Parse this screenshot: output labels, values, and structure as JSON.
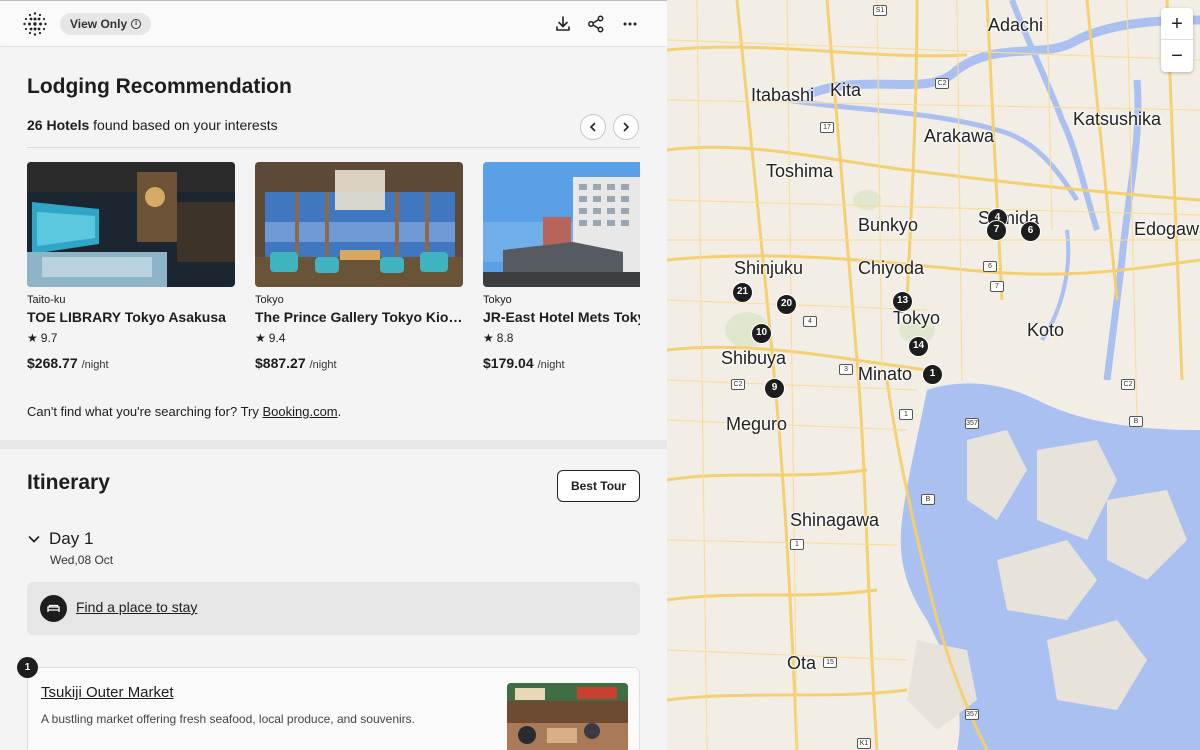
{
  "topbar": {
    "view_only_label": "View Only",
    "icons": [
      "logo-icon",
      "download-icon",
      "share-icon",
      "more-icon"
    ]
  },
  "lodging": {
    "title": "Lodging Recommendation",
    "count_number": "26 Hotels",
    "count_rest": "found based on your interests",
    "cant_find_prefix": "Can't find what you're searching for? Try",
    "cant_find_link": "Booking.com",
    "cant_find_suffix": ".",
    "hotels": [
      {
        "location": "Taito-ku",
        "name": "TOE LIBRARY Tokyo Asakusa",
        "rating": "9.7",
        "price": "$268.77",
        "unit": "/night"
      },
      {
        "location": "Tokyo",
        "name": "The Prince Gallery Tokyo Kioicho",
        "rating": "9.4",
        "price": "$887.27",
        "unit": "/night"
      },
      {
        "location": "Tokyo",
        "name": "JR-East Hotel Mets Tokyo",
        "rating": "8.8",
        "price": "$179.04",
        "unit": "/night"
      }
    ]
  },
  "itinerary": {
    "title": "Itinerary",
    "best_tour_label": "Best Tour",
    "day_label": "Day 1",
    "day_date": "Wed,08 Oct",
    "stay_link": "Find a place to stay",
    "places": [
      {
        "number": "1",
        "name": "Tsukiji Outer Market",
        "description": "A bustling market offering fresh seafood, local produce, and souvenirs."
      }
    ]
  },
  "map": {
    "zoom_in": "+",
    "zoom_out": "−",
    "labels": [
      "Adachi",
      "Itabashi",
      "Kita",
      "Katsushika",
      "Arakawa",
      "Toshima",
      "Bunkyo",
      "Sumida",
      "Edogawa",
      "Shinjuku",
      "Chiyoda",
      "Tokyo",
      "Koto",
      "Shibuya",
      "Minato",
      "Meguro",
      "Shinagawa",
      "Ota"
    ],
    "markers": [
      "4",
      "7",
      "6",
      "21",
      "20",
      "13",
      "10",
      "14",
      "1",
      "9"
    ],
    "road_badges": [
      "S1",
      "C2",
      "17",
      "6",
      "7",
      "4",
      "C2",
      "3",
      "1",
      "357",
      "B",
      "C2",
      "B",
      "1",
      "15",
      "357",
      "K1"
    ],
    "colors": {
      "water": "#aac0f0",
      "roads": "#f6cf6b",
      "land": "#f2eee6",
      "park": "#dfe8cf"
    }
  }
}
